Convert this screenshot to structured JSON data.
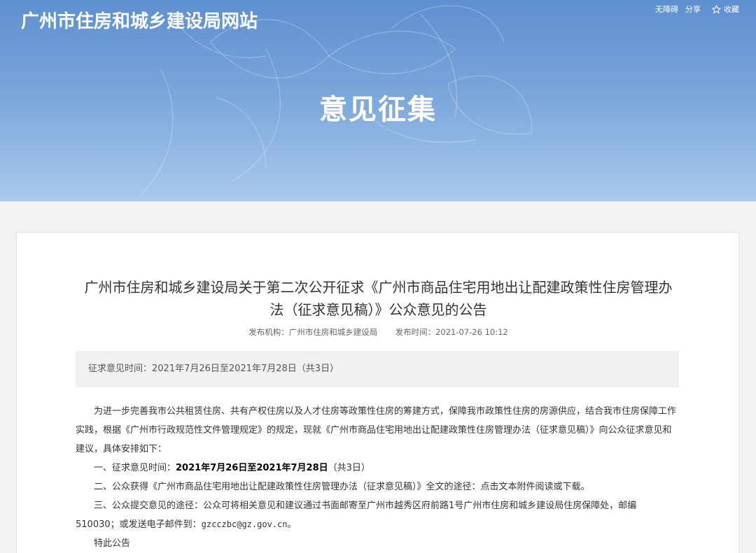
{
  "header": {
    "site_title": "广州市住房和城乡建设局网站",
    "links": {
      "accessibility": "无障碍",
      "share": "分享",
      "favorite": "收藏"
    },
    "section_title": "意见征集"
  },
  "article": {
    "title": "广州市住房和城乡建设局关于第二次公开征求《广州市商品住宅用地出让配建政策性住房管理办法（征求意见稿）》公众意见的公告",
    "publisher_label": "发布机构：",
    "publisher": "广州市住房和城乡建设局",
    "time_label": "发布时间：",
    "time": "2021-07-26 10:12",
    "period_box": "征求意见时间：2021年7月26日至2021年7月28日（共3日）",
    "paragraph1": "为进一步完善我市公共租赁住房、共有产权住房以及人才住房等政策性住房的筹建方式，保障我市政策性住房的房源供应，结合我市住房保障工作实践，根据《广州市行政规范性文件管理规定》的规定，现就《广州市商品住宅用地出让配建政策性住房管理办法（征求意见稿）》向公众征求意见和建议，具体安排如下：",
    "item1_prefix": "一、征求意见时间：",
    "item1_bold": "2021年7月26日至2021年7月28日",
    "item1_suffix": "（共3日）",
    "item2": "二、公众获得《广州市商品住宅用地出让配建政策性住房管理办法（征求意见稿）》全文的途径：点击文本附件阅读或下载。",
    "item3_prefix": "三、公众提交意见的途径：公众可将相关意见和建议通过书面邮寄至广州市越秀区府前路1号广州市住房和城乡建设局住房保障处，邮编51",
    "item3_zip_end": "0030",
    "item3_middle": "；或发送电子邮件到：",
    "item3_email": "gzcczbc@gz.gov.cn",
    "item3_end": "。",
    "closing": "特此公告"
  },
  "colors": {
    "banner_top": "#5e8fd0",
    "banner_bottom": "#a9c9ec",
    "page_bg": "#f2f2f2",
    "card_bg": "#ffffff",
    "period_bg": "#f1f1f1"
  }
}
